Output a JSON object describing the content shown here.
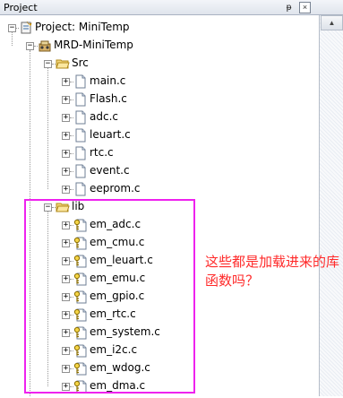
{
  "window": {
    "title": "Project",
    "pin_glyph": "ᵽ",
    "close_glyph": "×",
    "scroll_up_glyph": "▲"
  },
  "tree": {
    "project": {
      "label": "Project: MiniTemp",
      "expander": "−",
      "icon": "project-icon"
    },
    "target": {
      "label": "MRD-MiniTemp",
      "expander": "−",
      "icon": "target-icon"
    },
    "groups": [
      {
        "label": "Src",
        "expander": "−",
        "icon": "folder-open-icon",
        "files": [
          {
            "label": "main.c",
            "expander": "+",
            "icon": "file-icon"
          },
          {
            "label": "Flash.c",
            "expander": "+",
            "icon": "file-icon"
          },
          {
            "label": "adc.c",
            "expander": "+",
            "icon": "file-icon"
          },
          {
            "label": "leuart.c",
            "expander": "+",
            "icon": "file-icon"
          },
          {
            "label": "rtc.c",
            "expander": "+",
            "icon": "file-icon"
          },
          {
            "label": "event.c",
            "expander": "+",
            "icon": "file-icon"
          },
          {
            "label": "eeprom.c",
            "expander": "+",
            "icon": "file-icon"
          }
        ]
      },
      {
        "label": "lib",
        "expander": "−",
        "icon": "folder-open-icon",
        "files": [
          {
            "label": "em_adc.c",
            "expander": "+",
            "icon": "locked-file-icon"
          },
          {
            "label": "em_cmu.c",
            "expander": "+",
            "icon": "locked-file-icon"
          },
          {
            "label": "em_leuart.c",
            "expander": "+",
            "icon": "locked-file-icon"
          },
          {
            "label": "em_emu.c",
            "expander": "+",
            "icon": "locked-file-icon"
          },
          {
            "label": "em_gpio.c",
            "expander": "+",
            "icon": "locked-file-icon"
          },
          {
            "label": "em_rtc.c",
            "expander": "+",
            "icon": "locked-file-icon"
          },
          {
            "label": "em_system.c",
            "expander": "+",
            "icon": "locked-file-icon"
          },
          {
            "label": "em_i2c.c",
            "expander": "+",
            "icon": "locked-file-icon"
          },
          {
            "label": "em_wdog.c",
            "expander": "+",
            "icon": "locked-file-icon"
          },
          {
            "label": "em_dma.c",
            "expander": "+",
            "icon": "locked-file-icon"
          }
        ]
      }
    ]
  },
  "annotation": {
    "text": "这些都是加载进来的库函数吗？",
    "color": "#ff2a2a",
    "box_color": "#ee22ee"
  }
}
